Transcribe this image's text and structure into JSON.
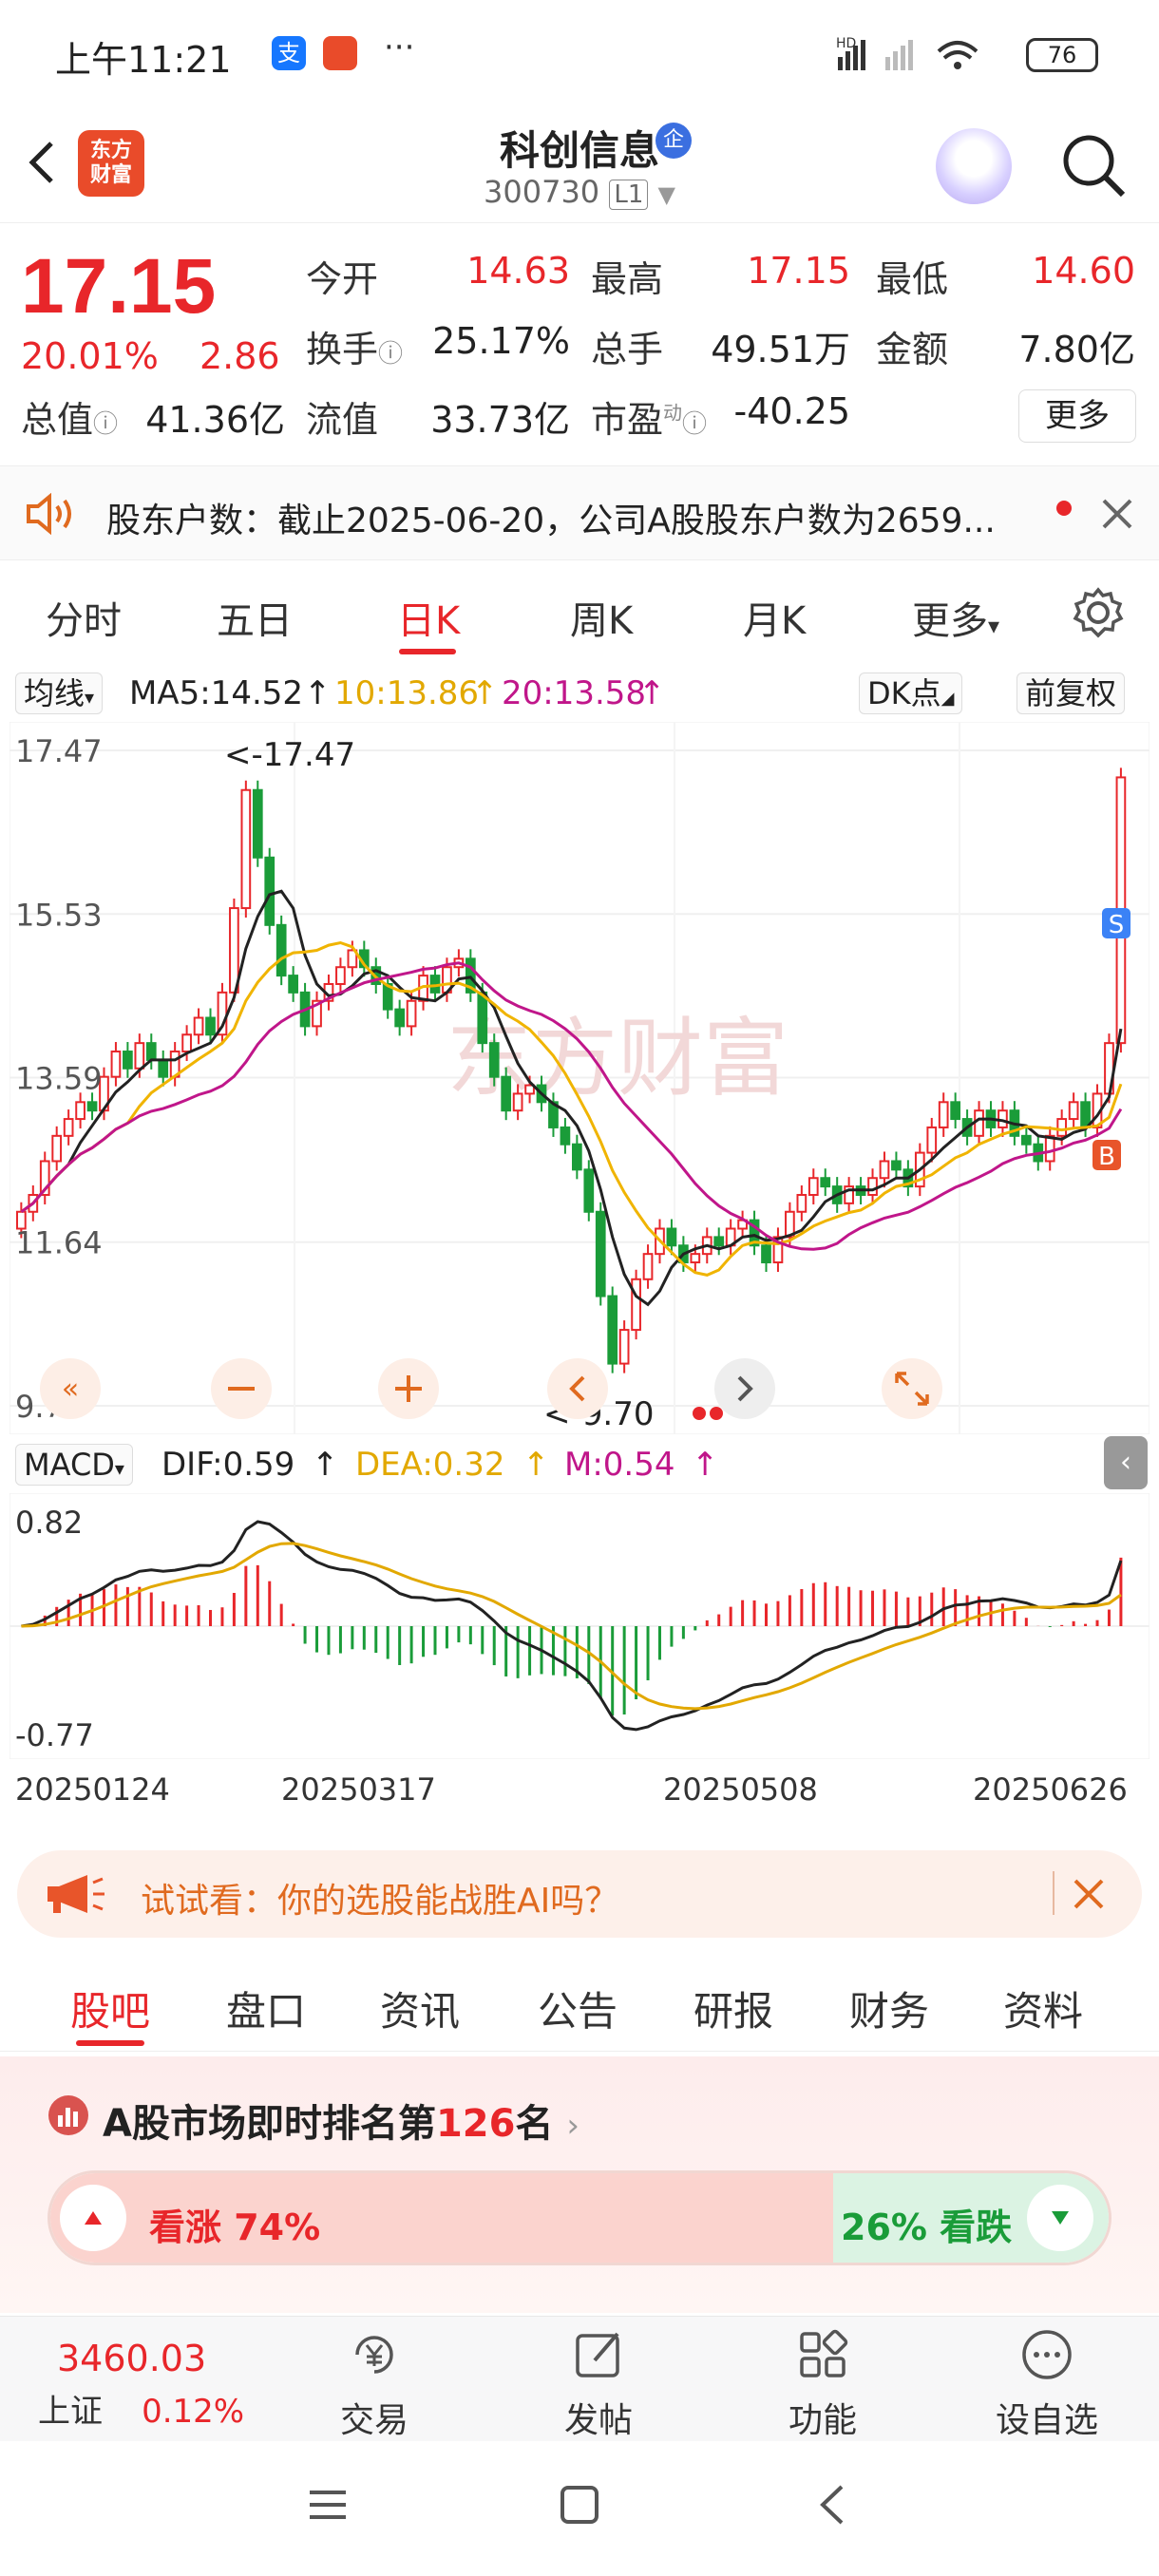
{
  "status_bar": {
    "time": "上午11:21",
    "battery": "76",
    "network": "HD"
  },
  "header": {
    "stock_name": "科创信息",
    "badge": "企",
    "stock_code": "300730",
    "level": "L1",
    "logo_text": "东方\n财富"
  },
  "quote": {
    "price": "17.15",
    "change_pct": "20.01%",
    "change": "2.86",
    "open_label": "今开",
    "open": "14.63",
    "high_label": "最高",
    "high": "17.15",
    "low_label": "最低",
    "low": "14.60",
    "turnover_label": "换手",
    "turnover": "25.17%",
    "volume_label": "总手",
    "volume": "49.51万",
    "amount_label": "金额",
    "amount": "7.80亿",
    "mktcap_label": "总值",
    "mktcap": "41.36亿",
    "float_label": "流值",
    "float_cap": "33.73亿",
    "pe_label": "市盈",
    "pe_sup": "动",
    "pe": "-40.25",
    "more_label": "更多"
  },
  "notice": {
    "text": "股东户数：截止2025-06-20，公司A股股东户数为2659..."
  },
  "kline_tabs": [
    "分时",
    "五日",
    "日K",
    "周K",
    "月K",
    "更多"
  ],
  "kline_active": "日K",
  "ma_bar": {
    "selector": "均线",
    "ma5": "MA5:14.52",
    "ma10": "10:13.86",
    "ma20": "20:13.58",
    "dk_label": "DK点",
    "adjust_label": "前复权"
  },
  "kline": {
    "y_labels": [
      "17.47",
      "15.53",
      "13.59",
      "11.64",
      "9.70"
    ],
    "max_label": "<-17.47",
    "min_label": "<-9.70",
    "watermark": "东方财富",
    "signal_s": "S",
    "signal_b": "B"
  },
  "macd_bar": {
    "selector": "MACD",
    "dif": "DIF:0.59",
    "dea": "DEA:0.32",
    "m": "M:0.54"
  },
  "macd": {
    "top": "0.82",
    "bottom": "-0.77"
  },
  "dates": [
    "20250124",
    "20250317",
    "20250508",
    "20250626"
  ],
  "ai_banner": {
    "text": "试试看：你的选股能战胜AI吗？"
  },
  "section_tabs": [
    "股吧",
    "盘口",
    "资讯",
    "公告",
    "研报",
    "财务",
    "资料"
  ],
  "section_active": "股吧",
  "ranking": {
    "prefix": "A股市场即时排名第",
    "rank": "126",
    "suffix": "名"
  },
  "vote": {
    "up_label": "看涨 74%",
    "down_label": "26% 看跌",
    "up_fraction": 0.74
  },
  "bottom_nav": {
    "index_value": "3460.03",
    "index_name": "上证",
    "index_change": "0.12%",
    "items": [
      "交易",
      "发帖",
      "功能",
      "设自选"
    ]
  },
  "colors": {
    "up": "#e8262a",
    "down": "#1a9c39",
    "ma5": "#222222",
    "ma10": "#f0b400",
    "ma20": "#c0168a"
  }
}
